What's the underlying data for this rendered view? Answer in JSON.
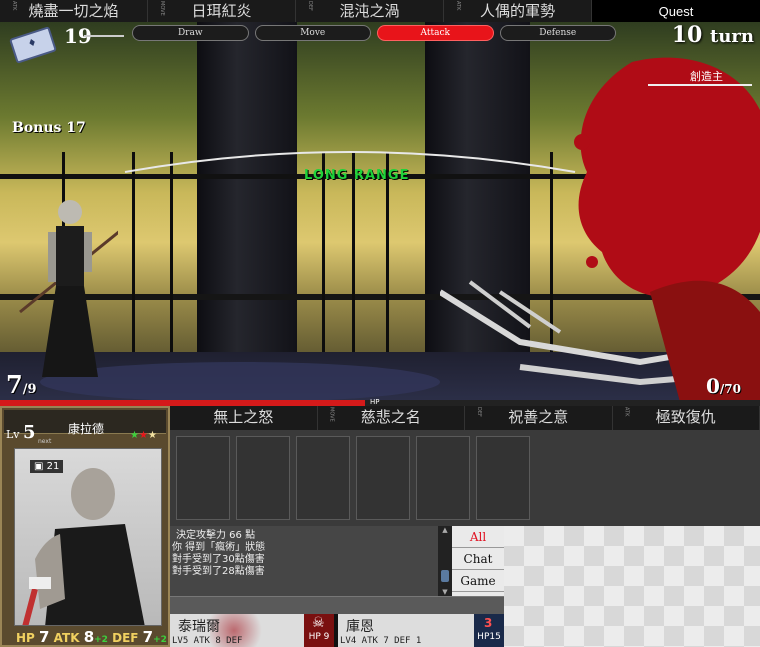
{
  "top_skills": [
    {
      "name": "燒盡一切之焰",
      "tag": "ATK"
    },
    {
      "name": "日珥紅炎",
      "tag": "MOVE"
    },
    {
      "name": "混沌之渦",
      "tag": "DEF"
    },
    {
      "name": "人偶的軍勢",
      "tag": "ATK"
    }
  ],
  "quest_label": "Quest",
  "phases": [
    {
      "label": "Draw",
      "active": false
    },
    {
      "label": "Move",
      "active": false
    },
    {
      "label": "Attack",
      "active": true
    },
    {
      "label": "Defense",
      "active": false
    }
  ],
  "deck": {
    "count": "19"
  },
  "bonus": "Bonus 17",
  "turn": {
    "number": "10",
    "word": "turn"
  },
  "enemy_name": "創造主",
  "distance_label": "LONG RANGE",
  "player_hp": {
    "current": "7",
    "max": "/9"
  },
  "enemy_hp": {
    "current": "0",
    "max": "/70"
  },
  "hp_bar_label": "HP",
  "hp_bar_fraction": 0.48,
  "card": {
    "name": "康拉德",
    "lv_label": "Lv",
    "level": "5",
    "next_label": "next",
    "badge": "21",
    "hp_label": "HP",
    "hp": "7",
    "atk_label": "ATK",
    "atk": "8",
    "atk_bonus": "+2",
    "def_label": "DEF",
    "def": "7",
    "def_bonus": "+2"
  },
  "bottom_skills": [
    {
      "name": "無上之怒",
      "tag": ""
    },
    {
      "name": "慈悲之名",
      "tag": "MOVE"
    },
    {
      "name": "祝善之意",
      "tag": "DEF"
    },
    {
      "name": "極致復仇",
      "tag": "ATK"
    }
  ],
  "log_lines": [
    "決定攻擊力 66 點",
    "你 得到「瘋術」狀態",
    "對手受到了30點傷害",
    "對手受到了28點傷害"
  ],
  "chat_tabs": [
    {
      "label": "All",
      "active": true
    },
    {
      "label": "Chat",
      "active": false
    },
    {
      "label": "Game",
      "active": false
    }
  ],
  "roster": [
    {
      "name": "泰瑞爾",
      "stats": "LV5  ATK 8  DEF",
      "hp": "HP 9",
      "color": "#7a1010"
    },
    {
      "name": "庫恩",
      "stats": "LV4  ATK 7  DEF 1",
      "hp": "HP15",
      "hp_top": "3",
      "color": "#1a2a4a"
    }
  ],
  "colors": {
    "accent_red": "#e8141a",
    "range_green": "#1fd23a",
    "blood": "#b00c16"
  }
}
